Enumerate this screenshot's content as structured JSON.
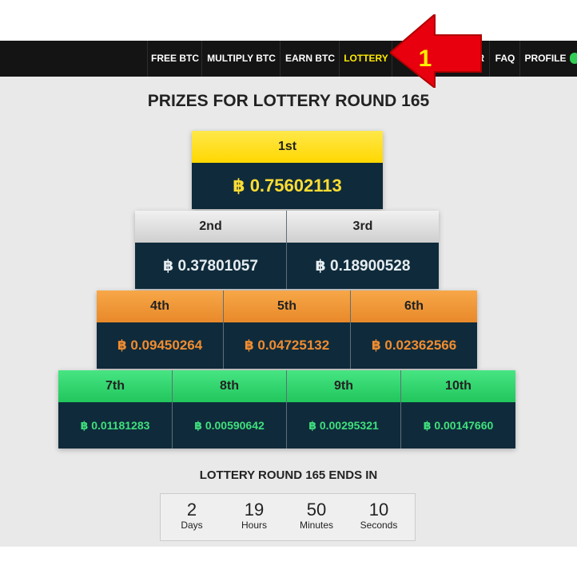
{
  "nav": {
    "items": [
      {
        "label": "FREE BTC"
      },
      {
        "label": "MULTIPLY BTC"
      },
      {
        "label": "EARN BTC"
      },
      {
        "label": "LOTTERY",
        "active": true
      },
      {
        "label": "R"
      },
      {
        "label": "FAQ"
      },
      {
        "label": "PROFILE"
      }
    ],
    "active_color": "#ffea00",
    "bg_color": "#141414"
  },
  "annotation": {
    "number": "1",
    "arrow_color": "#e8000e",
    "number_color": "#ffee00",
    "icon": "red-arrow-icon"
  },
  "title": "PRIZES FOR LOTTERY ROUND 165",
  "prizes": [
    {
      "place": "1st",
      "amount": "฿ 0.75602113"
    },
    {
      "place": "2nd",
      "amount": "฿ 0.37801057"
    },
    {
      "place": "3rd",
      "amount": "฿ 0.18900528"
    },
    {
      "place": "4th",
      "amount": "฿ 0.09450264"
    },
    {
      "place": "5th",
      "amount": "฿ 0.04725132"
    },
    {
      "place": "6th",
      "amount": "฿ 0.02362566"
    },
    {
      "place": "7th",
      "amount": "฿ 0.01181283"
    },
    {
      "place": "8th",
      "amount": "฿ 0.00590642"
    },
    {
      "place": "9th",
      "amount": "฿ 0.00295321"
    },
    {
      "place": "10th",
      "amount": "฿ 0.00147660"
    }
  ],
  "countdown": {
    "label": "LOTTERY ROUND 165 ENDS IN",
    "units": [
      {
        "value": "2",
        "label": "Days"
      },
      {
        "value": "19",
        "label": "Hours"
      },
      {
        "value": "50",
        "label": "Minutes"
      },
      {
        "value": "10",
        "label": "Seconds"
      }
    ]
  }
}
